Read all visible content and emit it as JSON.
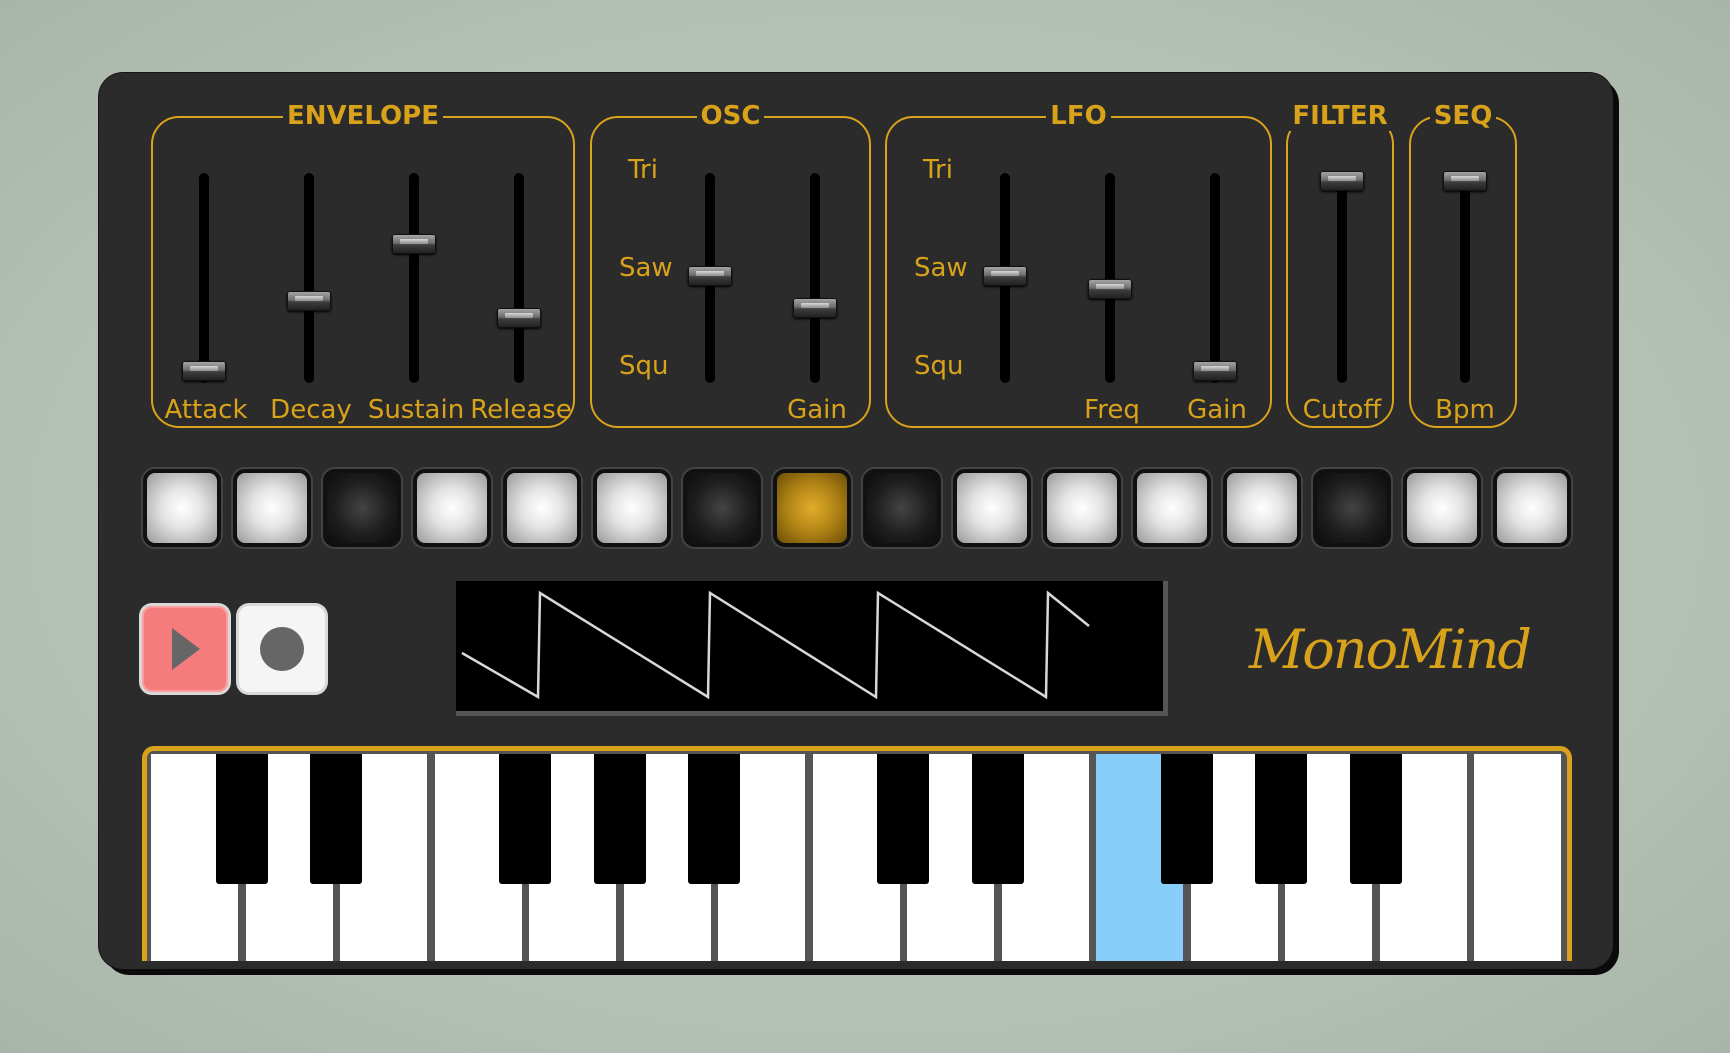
{
  "panels": {
    "envelope": {
      "title": "ENVELOPE",
      "sliders": [
        {
          "label": "Attack",
          "value": 0.0
        },
        {
          "label": "Decay",
          "value": 0.37
        },
        {
          "label": "Sustain",
          "value": 0.67
        },
        {
          "label": "Release",
          "value": 0.28
        }
      ]
    },
    "osc": {
      "title": "OSC",
      "waveforms": [
        "Tri",
        "Saw",
        "Squ"
      ],
      "waveform_value": 0.5,
      "gain": {
        "label": "Gain",
        "value": 0.33
      }
    },
    "lfo": {
      "title": "LFO",
      "waveforms": [
        "Tri",
        "Saw",
        "Squ"
      ],
      "waveform_value": 0.5,
      "freq": {
        "label": "Freq",
        "value": 0.43
      },
      "gain": {
        "label": "Gain",
        "value": 0.0
      }
    },
    "filter": {
      "title": "FILTER",
      "cutoff": {
        "label": "Cutoff",
        "value": 1.0
      }
    },
    "seq": {
      "title": "SEQ",
      "bpm": {
        "label": "Bpm",
        "value": 1.0
      }
    }
  },
  "sequencer": {
    "steps": [
      "on",
      "on",
      "off",
      "on",
      "on",
      "on",
      "off",
      "current",
      "off",
      "on",
      "on",
      "on",
      "on",
      "off",
      "on",
      "on"
    ]
  },
  "transport": {
    "play_icon": "play-icon",
    "record_icon": "record-icon"
  },
  "scope": {
    "waveform": "sawtooth"
  },
  "brand": "MonoMind",
  "keyboard": {
    "white_keys": 15,
    "active_white_key": 10
  },
  "colors": {
    "accent": "#d9a21b",
    "panel": "#2b2b2b",
    "play": "#f47c7c",
    "active_key": "#87cefa"
  }
}
